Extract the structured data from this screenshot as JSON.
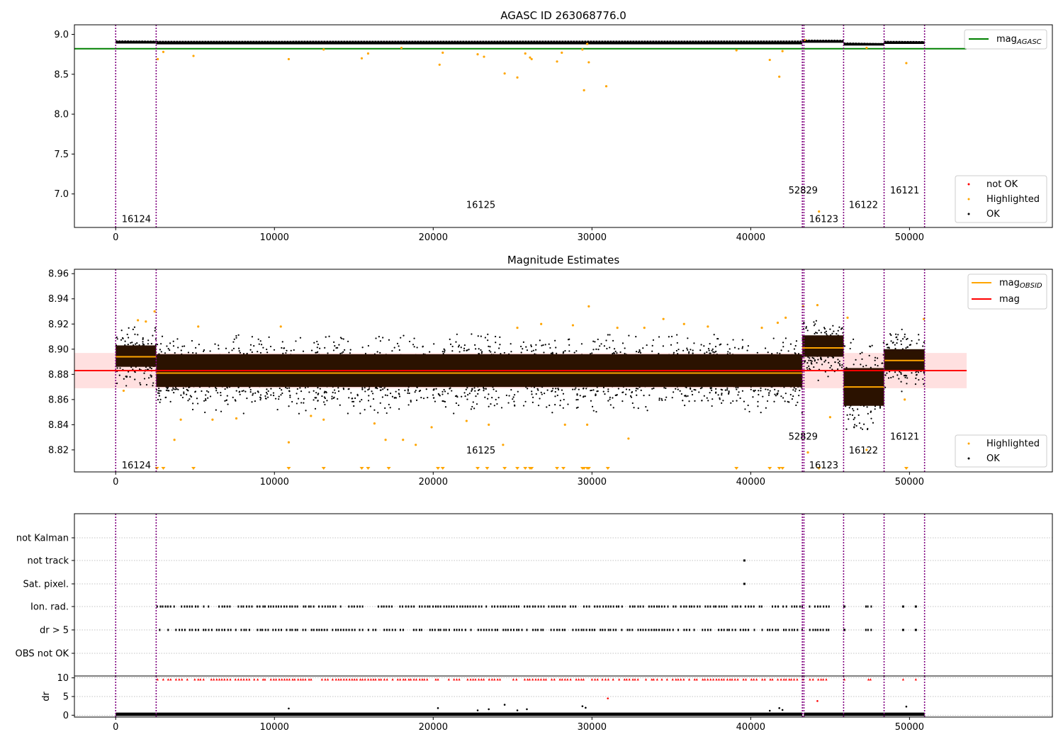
{
  "chart_data": [
    {
      "type": "scatter",
      "title": "AGASC ID 263068776.0",
      "xlim": [
        -2600,
        59000
      ],
      "ylim": [
        6.58,
        9.12
      ],
      "yticks": [
        7.0,
        7.5,
        8.0,
        8.5,
        9.0
      ],
      "xticks": [
        0,
        10000,
        20000,
        30000,
        40000,
        50000
      ],
      "xticks_shown": true,
      "mag_agasc": 8.82,
      "mag_agasc_x_end": 53600,
      "segment_boundaries": [
        0,
        2550,
        43250,
        43350,
        45850,
        48400,
        50950
      ],
      "obsid_labels": [
        {
          "text": "16124",
          "x": 1300,
          "y": 6.69
        },
        {
          "text": "16125",
          "x": 23000,
          "y": 6.87
        },
        {
          "text": "52829",
          "x": 43300,
          "y": 7.05
        },
        {
          "text": "16123",
          "x": 44600,
          "y": 6.69
        },
        {
          "text": "16122",
          "x": 47100,
          "y": 6.87
        },
        {
          "text": "16121",
          "x": 49700,
          "y": 7.05
        }
      ],
      "bands": [
        {
          "x0": 0,
          "x1": 2550,
          "y0": 8.885,
          "y1": 8.915,
          "color": "#000000"
        },
        {
          "x0": 2550,
          "x1": 43250,
          "y0": 8.875,
          "y1": 8.91,
          "color": "#000000"
        },
        {
          "x0": 43250,
          "x1": 45850,
          "y0": 8.895,
          "y1": 8.925,
          "color": "#000000"
        },
        {
          "x0": 45850,
          "x1": 48400,
          "y0": 8.86,
          "y1": 8.89,
          "color": "#000000"
        },
        {
          "x0": 48400,
          "x1": 50950,
          "y0": 8.88,
          "y1": 8.91,
          "color": "#000000"
        }
      ],
      "highlighted": [
        [
          2650,
          8.69
        ],
        [
          3000,
          8.78
        ],
        [
          4900,
          8.73
        ],
        [
          10900,
          8.69
        ],
        [
          13100,
          8.81
        ],
        [
          15500,
          8.7
        ],
        [
          15900,
          8.76
        ],
        [
          18000,
          8.83
        ],
        [
          20400,
          8.62
        ],
        [
          20600,
          8.77
        ],
        [
          22800,
          8.75
        ],
        [
          23200,
          8.72
        ],
        [
          24500,
          8.51
        ],
        [
          25300,
          8.46
        ],
        [
          25800,
          8.76
        ],
        [
          26100,
          8.71
        ],
        [
          26200,
          8.69
        ],
        [
          27800,
          8.66
        ],
        [
          28100,
          8.77
        ],
        [
          29400,
          8.81
        ],
        [
          29500,
          8.3
        ],
        [
          29700,
          8.88
        ],
        [
          29800,
          8.65
        ],
        [
          30900,
          8.35
        ],
        [
          39100,
          8.8
        ],
        [
          41200,
          8.68
        ],
        [
          41800,
          8.47
        ],
        [
          42000,
          8.79
        ],
        [
          43400,
          8.93
        ],
        [
          44300,
          6.78
        ],
        [
          47300,
          8.83
        ],
        [
          49800,
          8.64
        ]
      ],
      "series": [
        {
          "name": "not OK",
          "color": "#ff0000",
          "marker": "point"
        },
        {
          "name": "Highlighted",
          "color": "#ffa500",
          "marker": "point"
        },
        {
          "name": "OK",
          "color": "#000000",
          "marker": "point"
        }
      ],
      "legend_top": [
        {
          "name": "mag_AGASC",
          "label": "mag",
          "sub": "AGASC",
          "color": "#008000"
        }
      ],
      "legend_placement": [
        "top-right",
        "bottom-right"
      ]
    },
    {
      "type": "scatter",
      "title": "Magnitude Estimates",
      "xlim": [
        -2600,
        59000
      ],
      "ylim": [
        8.8025,
        8.9635
      ],
      "yticks": [
        8.82,
        8.84,
        8.86,
        8.88,
        8.9,
        8.92,
        8.94,
        8.96
      ],
      "xticks": [
        0,
        10000,
        20000,
        30000,
        40000,
        50000
      ],
      "xticks_shown": true,
      "mag": 8.883,
      "mag_band": [
        8.869,
        8.897
      ],
      "mag_x_end": 53600,
      "segment_boundaries": [
        0,
        2550,
        43250,
        43350,
        45850,
        48400,
        50950
      ],
      "obsid_labels": [
        {
          "text": "16124",
          "x": 1300,
          "y": 8.808
        },
        {
          "text": "16125",
          "x": 23000,
          "y": 8.82
        },
        {
          "text": "52829",
          "x": 43300,
          "y": 8.831
        },
        {
          "text": "16123",
          "x": 44600,
          "y": 8.808
        },
        {
          "text": "16122",
          "x": 47100,
          "y": 8.82
        },
        {
          "text": "16121",
          "x": 49700,
          "y": 8.831
        }
      ],
      "segments": [
        {
          "x0": 0,
          "x1": 2550,
          "mag_obsid": 8.894,
          "box": [
            8.886,
            8.903
          ],
          "spread": [
            8.868,
            8.918
          ]
        },
        {
          "x0": 2550,
          "x1": 43250,
          "mag_obsid": 8.881,
          "box": [
            8.87,
            8.896
          ],
          "spread": [
            8.848,
            8.912
          ]
        },
        {
          "x0": 43250,
          "x1": 45850,
          "mag_obsid": 8.901,
          "box": [
            8.894,
            8.911
          ],
          "spread": [
            8.875,
            8.927
          ]
        },
        {
          "x0": 45850,
          "x1": 48400,
          "mag_obsid": 8.87,
          "box": [
            8.855,
            8.885
          ],
          "spread": [
            8.836,
            8.914
          ]
        },
        {
          "x0": 48400,
          "x1": 50950,
          "mag_obsid": 8.891,
          "box": [
            8.883,
            8.9
          ],
          "spread": [
            8.866,
            8.918
          ]
        }
      ],
      "highlighted": [
        [
          500,
          8.867
        ],
        [
          1400,
          8.923
        ],
        [
          1900,
          8.922
        ],
        [
          2450,
          8.93
        ],
        [
          3700,
          8.828
        ],
        [
          4100,
          8.844
        ],
        [
          5200,
          8.918
        ],
        [
          6100,
          8.844
        ],
        [
          7600,
          8.845
        ],
        [
          10400,
          8.918
        ],
        [
          10900,
          8.826
        ],
        [
          12300,
          8.847
        ],
        [
          13100,
          8.844
        ],
        [
          16300,
          8.841
        ],
        [
          17000,
          8.828
        ],
        [
          18100,
          8.828
        ],
        [
          18900,
          8.824
        ],
        [
          19900,
          8.838
        ],
        [
          22100,
          8.843
        ],
        [
          23500,
          8.84
        ],
        [
          24400,
          8.824
        ],
        [
          25300,
          8.917
        ],
        [
          26800,
          8.92
        ],
        [
          28300,
          8.84
        ],
        [
          28800,
          8.919
        ],
        [
          29700,
          8.84
        ],
        [
          29800,
          8.934
        ],
        [
          31600,
          8.917
        ],
        [
          32300,
          8.829
        ],
        [
          33300,
          8.917
        ],
        [
          34500,
          8.924
        ],
        [
          35800,
          8.92
        ],
        [
          37300,
          8.918
        ],
        [
          40700,
          8.917
        ],
        [
          41700,
          8.921
        ],
        [
          42200,
          8.925
        ],
        [
          43300,
          8.934
        ],
        [
          43600,
          8.818
        ],
        [
          44200,
          8.935
        ],
        [
          45000,
          8.846
        ],
        [
          46100,
          8.925
        ],
        [
          47300,
          8.82
        ],
        [
          49700,
          8.86
        ],
        [
          50900,
          8.924
        ]
      ],
      "offscale": [
        2600,
        3000,
        4900,
        10900,
        13100,
        15500,
        15900,
        17200,
        20300,
        20600,
        22800,
        23400,
        24500,
        25300,
        25800,
        26100,
        26200,
        27800,
        28200,
        29400,
        29500,
        29700,
        29800,
        31000,
        39100,
        41200,
        41800,
        42000,
        44300,
        49800
      ],
      "series": [
        {
          "name": "Highlighted",
          "color": "#ffa500",
          "marker": "point"
        },
        {
          "name": "OK",
          "color": "#000000",
          "marker": "point"
        }
      ],
      "legend_top": [
        {
          "name": "mag_OBSID",
          "label": "mag",
          "sub": "OBSID",
          "color": "#ffa500"
        },
        {
          "name": "mag",
          "label": "mag",
          "sub": "",
          "color": "#ff0000"
        }
      ],
      "legend_placement": [
        "top-right",
        "bottom-right"
      ]
    },
    {
      "type": "scatter",
      "title": "",
      "xlim": [
        -2600,
        59000
      ],
      "categories": [
        "not Kalman",
        "not track",
        "Sat. pixel.",
        "Ion. rad.",
        "dr > 5",
        "OBS not OK"
      ],
      "flag_rows": {
        "not Kalman": [],
        "not track": [
          39600
        ],
        "Sat. pixel.": [
          39600
        ],
        "Ion. rad.": [
          [
            2600,
            43250
          ],
          [
            43700,
            44900
          ],
          [
            45900
          ],
          [
            47200,
            47600
          ],
          [
            49600
          ],
          [
            50400
          ]
        ],
        "dr > 5": [
          [
            2600,
            43250
          ],
          [
            43700,
            44900
          ],
          [
            45900
          ],
          [
            47200,
            47600
          ],
          [
            49600
          ],
          [
            50400
          ]
        ],
        "OBS not OK": []
      },
      "segment_boundaries": [
        0,
        2550,
        43250,
        43350,
        45850,
        48400,
        50950
      ]
    },
    {
      "type": "scatter",
      "title": "",
      "xlim": [
        -2600,
        59000
      ],
      "ylim": [
        -0.5,
        10.5
      ],
      "yticks": [
        0,
        5,
        10
      ],
      "ylabel": "dr",
      "xticks": [
        0,
        10000,
        20000,
        30000,
        40000,
        50000
      ],
      "xticks_shown": true,
      "clipped_red": [
        [
          2600,
          43250
        ],
        [
          43700,
          44900
        ],
        [
          45900
        ],
        [
          47200,
          47600
        ],
        [
          49600
        ],
        [
          50400
        ]
      ],
      "clipped_value": 9.6,
      "outliers_red": [
        [
          31000,
          4.5
        ],
        [
          44200,
          3.8
        ]
      ],
      "outliers_black": [
        [
          10900,
          1.8
        ],
        [
          20300,
          1.9
        ],
        [
          22800,
          1.3
        ],
        [
          23500,
          1.6
        ],
        [
          24500,
          2.8
        ],
        [
          25300,
          1.3
        ],
        [
          25900,
          1.6
        ],
        [
          29400,
          2.4
        ],
        [
          29600,
          2.0
        ],
        [
          41200,
          1.2
        ],
        [
          41800,
          1.9
        ],
        [
          42000,
          1.4
        ],
        [
          49800,
          2.3
        ]
      ],
      "segment_boundaries": [
        0,
        2550,
        43250,
        43350,
        45850,
        48400,
        50950
      ]
    }
  ]
}
